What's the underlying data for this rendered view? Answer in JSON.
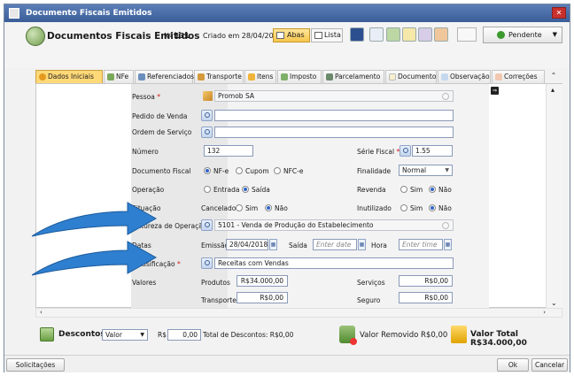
{
  "window": {
    "title": "Documento Fiscais Emitidos"
  },
  "header": {
    "title": "Documentos Fiscais Emitidos",
    "num_label": "Nº",
    "num_value": "131",
    "created": "Criado em 28/04/2018",
    "abas_label": "Abas",
    "lista_label": "Lista",
    "status_label": "Pendente"
  },
  "tabs": [
    {
      "label": "Dados Iniciais"
    },
    {
      "label": "NFe"
    },
    {
      "label": "Referenciados"
    },
    {
      "label": "Transporte"
    },
    {
      "label": "Itens"
    },
    {
      "label": "Imposto"
    },
    {
      "label": "Parcelamento"
    },
    {
      "label": "Documento"
    },
    {
      "label": "Observação"
    },
    {
      "label": "Correções"
    }
  ],
  "form": {
    "pessoa": {
      "label": "Pessoa",
      "value": "Promob SA"
    },
    "pedido": {
      "label": "Pedido de Venda",
      "value": ""
    },
    "ordem": {
      "label": "Ordem de Serviço",
      "value": ""
    },
    "numero": {
      "label": "Número",
      "value": "132"
    },
    "serie": {
      "label": "Série Fiscal",
      "value": "1.55"
    },
    "docfiscal": {
      "label": "Documento Fiscal",
      "options": [
        "NF-e",
        "Cupom",
        "NFC-e"
      ],
      "selected": "NF-e"
    },
    "finalidade": {
      "label": "Finalidade",
      "value": "Normal"
    },
    "operacao": {
      "label": "Operação",
      "options": [
        "Entrada",
        "Saída"
      ],
      "selected": "Saída"
    },
    "revenda": {
      "label": "Revenda",
      "options": [
        "Sim",
        "Não"
      ],
      "selected": "Não"
    },
    "situacao": {
      "label": "Situação",
      "value": "Cancelado",
      "options": [
        "Sim",
        "Não"
      ],
      "selected": "Não"
    },
    "inutilizado": {
      "label": "Inutilizado",
      "options": [
        "Sim",
        "Não"
      ],
      "selected": "Não"
    },
    "natureza": {
      "label": "Natureza de Operação",
      "value": "5101 - Venda de Produção do Estabelecimento"
    },
    "datas": {
      "label": "Datas",
      "emissao_label": "Emissão",
      "emissao": "28/04/2018",
      "saida_label": "Saída",
      "saida_placeholder": "Enter date",
      "hora_label": "Hora",
      "hora_placeholder": "Enter time"
    },
    "classificacao": {
      "label": "Classificação",
      "value": "Receitas com Vendas"
    },
    "valores": {
      "label": "Valores",
      "produtos_label": "Produtos",
      "produtos": "R$34.000,00",
      "servicos_label": "Serviços",
      "servicos": "R$0,00",
      "transporte_label": "Transporte",
      "transporte": "R$0,00",
      "seguro_label": "Seguro",
      "seguro": "R$0,00"
    }
  },
  "footer": {
    "descontos_label": "Descontos",
    "descontos_type": "Valor",
    "currency": "R$",
    "descontos_value": "0,00",
    "total_descontos": "Total de Descontos: R$0,00",
    "valor_removido": "Valor Removido R$0,00",
    "valor_total": "Valor Total R$34.000,00"
  },
  "bottom": {
    "solicitacoes": "Solicitações",
    "ok": "Ok",
    "cancelar": "Cancelar"
  },
  "colors": {
    "title_bar": "#3a5d98",
    "active_tab": "#ffd978",
    "arrow": "#2f7fd0",
    "required": "#d21414"
  }
}
